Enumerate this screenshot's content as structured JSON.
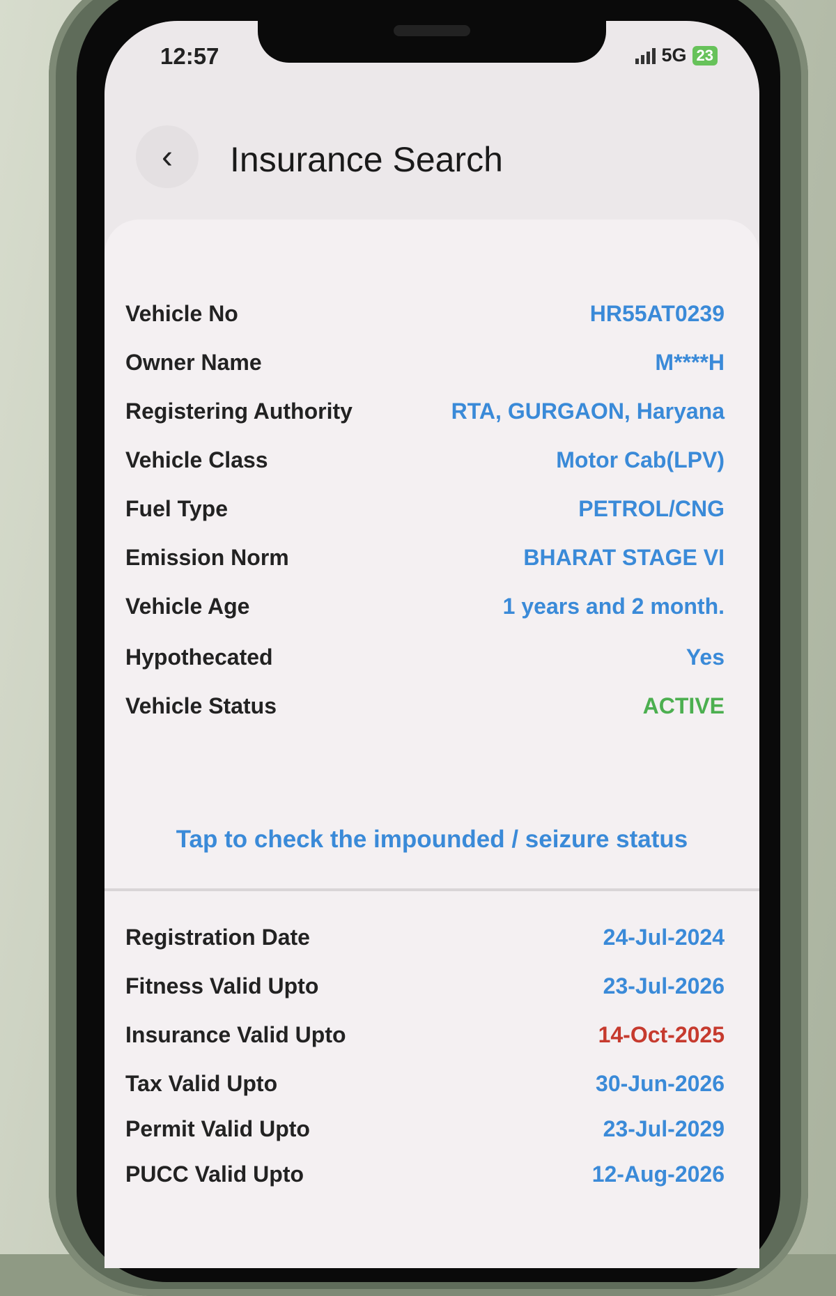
{
  "status_bar": {
    "time": "12:57",
    "network": "5G",
    "battery": "23"
  },
  "header": {
    "title": "Insurance Search",
    "back_icon": "‹"
  },
  "vehicle_details": [
    {
      "label": "Vehicle No",
      "value": "HR55AT0239"
    },
    {
      "label": "Owner Name",
      "value": "M****H"
    },
    {
      "label": "Registering Authority",
      "value": "RTA, GURGAON, Haryana"
    },
    {
      "label": "Vehicle Class",
      "value": "Motor Cab(LPV)"
    },
    {
      "label": "Fuel Type",
      "value": "PETROL/CNG"
    },
    {
      "label": "Emission Norm",
      "value": "BHARAT STAGE VI"
    },
    {
      "label": "Vehicle Age",
      "value": "1 years and 2 month."
    },
    {
      "label": "Hypothecated",
      "value": "Yes"
    },
    {
      "label": "Vehicle Status",
      "value": "ACTIVE"
    }
  ],
  "seizure_link": "Tap to check the impounded / seizure status",
  "validity_details": [
    {
      "label": "Registration Date",
      "value": "24-Jul-2024"
    },
    {
      "label": "Fitness Valid Upto",
      "value": "23-Jul-2026"
    },
    {
      "label": "Insurance Valid Upto",
      "value": "14-Oct-2025"
    },
    {
      "label": "Tax Valid Upto",
      "value": "30-Jun-2026"
    },
    {
      "label": "Permit Valid Upto",
      "value": "23-Jul-2029"
    },
    {
      "label": "PUCC Valid Upto",
      "value": "12-Aug-2026"
    }
  ],
  "colors": {
    "value_blue": "#3a8ad8",
    "status_green": "#4caf50",
    "expiry_red": "#c63a2e"
  }
}
